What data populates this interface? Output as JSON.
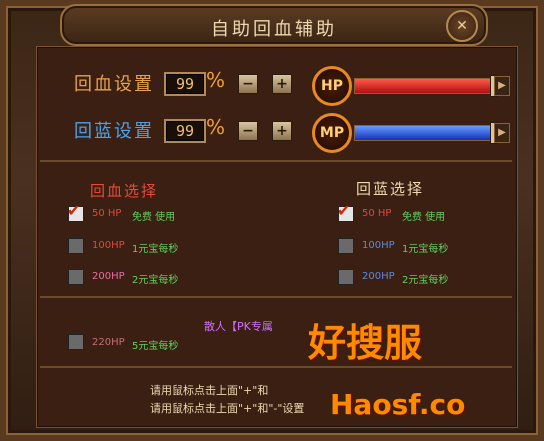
{
  "window": {
    "title": "自助回血辅助"
  },
  "hp_row": {
    "label": "回血设置",
    "value": "99",
    "percent": "%",
    "orb": "HP",
    "bar_level_pct": 92
  },
  "mp_row": {
    "label": "回蓝设置",
    "value": "99",
    "percent": "%",
    "orb": "MP",
    "bar_level_pct": 92
  },
  "sections": {
    "hp_title": "回血选择",
    "mp_title": "回蓝选择"
  },
  "hp_options": [
    {
      "amount": "50 HP",
      "cost": "免费 使用",
      "checked": true
    },
    {
      "amount": "100HP",
      "cost": "1元宝每秒",
      "checked": false
    },
    {
      "amount": "200HP",
      "cost": "2元宝每秒",
      "checked": false
    }
  ],
  "mp_options": [
    {
      "amount": "50 HP",
      "cost": "免费 使用",
      "checked": true
    },
    {
      "amount": "100HP",
      "cost": "1元宝每秒",
      "checked": false
    },
    {
      "amount": "200HP",
      "cost": "2元宝每秒",
      "checked": false
    }
  ],
  "pk_note": "散人【PK专属",
  "hp_extra": {
    "amount": "220HP",
    "cost": "5元宝每秒",
    "checked": false
  },
  "help": {
    "line1": "请用鼠标点击上面\"+\"和",
    "line2": "请用鼠标点击上面\"+\"和\"-\"设置"
  },
  "watermark": {
    "top": "好搜服",
    "bottom": "Haosf.co"
  },
  "colors": {
    "hp_bar": "#d01818",
    "mp_bar": "#1a3ed8",
    "accent": "#e88a20"
  }
}
